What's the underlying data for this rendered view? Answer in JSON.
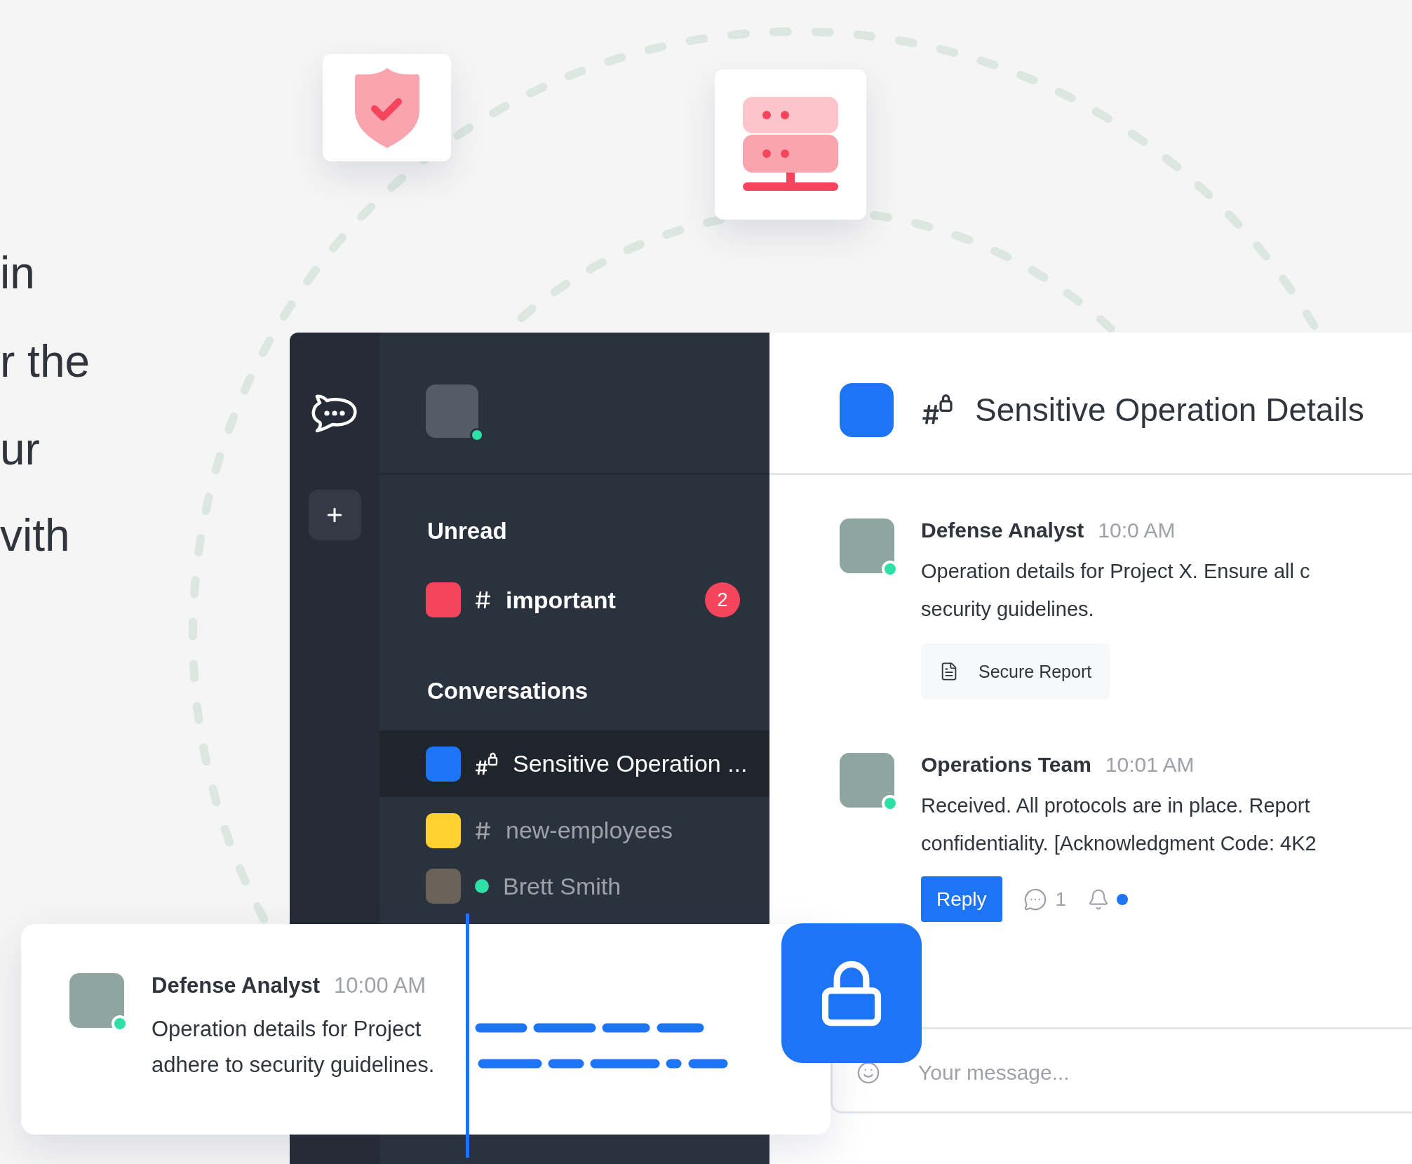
{
  "intro_text_fragments": [
    "in",
    "r the",
    "ur",
    "vith"
  ],
  "app": {
    "sidebar": {
      "sections": [
        {
          "title": "Unread",
          "items": [
            {
              "kind": "channel",
              "name": "important",
              "color": "#f5455c",
              "unread": "2",
              "selected": false
            }
          ]
        },
        {
          "title": "Conversations",
          "items": [
            {
              "kind": "private_channel",
              "name": "Sensitive Operation ...",
              "color": "#1d74f5",
              "selected": true
            },
            {
              "kind": "channel",
              "name": "new-employees",
              "color": "#ffd031",
              "selected": false
            },
            {
              "kind": "direct",
              "name": "Brett Smith",
              "online": true,
              "selected": false
            }
          ]
        }
      ]
    },
    "room": {
      "kind": "private_channel",
      "title": "Sensitive Operation Details"
    },
    "messages": [
      {
        "author": "Defense Analyst",
        "time": "10:0 AM",
        "online": true,
        "lines": [
          "Operation details for Project X. Ensure all c",
          "security guidelines."
        ],
        "attachment": "Secure Report"
      },
      {
        "author": "Operations Team",
        "time": "10:01 AM",
        "online": true,
        "lines": [
          "Received. All protocols are in place. Report",
          "confidentiality. [Acknowledgment Code: 4K2"
        ],
        "actions": {
          "reply": "Reply",
          "thread_count": "1",
          "unread_dot": true
        }
      }
    ],
    "composer": {
      "placeholder": "Your message..."
    }
  },
  "floating_card": {
    "author": "Defense Analyst",
    "time": "10:00 AM",
    "online": true,
    "lines": [
      "Operation details for Project",
      "adhere to security guidelines."
    ]
  }
}
